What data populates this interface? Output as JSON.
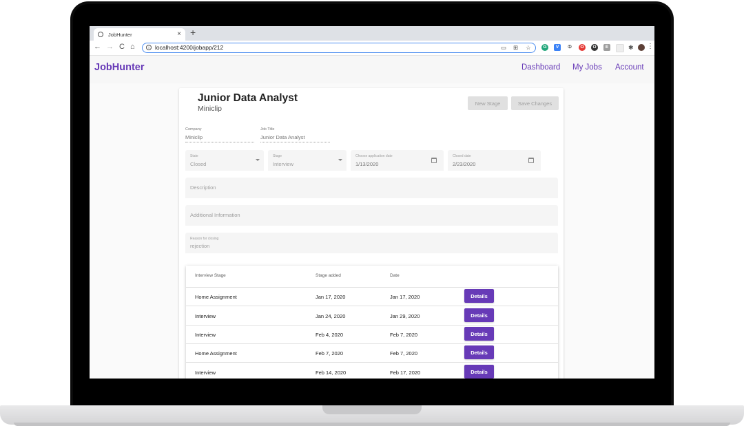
{
  "browser": {
    "tab_title": "JobHunter",
    "tab_close": "×",
    "new_tab": "+",
    "url": "localhost:4200/jobapp/212",
    "nav": {
      "back": "←",
      "forward": "→",
      "reload": "C",
      "home": "⌂"
    },
    "omnibox_icons": [
      "▭",
      "⊞",
      "☆"
    ],
    "extensions": [
      {
        "glyph": "G",
        "color": "#21a67a"
      },
      {
        "glyph": "V",
        "color": "#3b82f6"
      },
      {
        "glyph": "①",
        "color": "#444444"
      },
      {
        "glyph": "O",
        "color": "#e53935"
      },
      {
        "glyph": "O",
        "color": "#333333"
      },
      {
        "glyph": "E",
        "color": "#9e9e9e"
      },
      {
        "glyph": "",
        "color": "#eeeeee"
      }
    ],
    "menu": "⋮"
  },
  "app": {
    "brand": "JobHunter",
    "nav": {
      "dashboard": "Dashboard",
      "my_jobs": "My Jobs",
      "account": "Account"
    }
  },
  "job": {
    "title": "Junior Data Analyst",
    "company_name": "Miniclip",
    "buttons": {
      "new_stage": "New Stage",
      "save_changes": "Save Changes"
    },
    "fields": {
      "company": {
        "label": "Company",
        "value": "Miniclip"
      },
      "job_title": {
        "label": "Job Title",
        "value": "Junior Data Analyst"
      },
      "state": {
        "label": "State",
        "value": "Closed"
      },
      "stage": {
        "label": "Stage",
        "value": "Interview"
      },
      "application_date": {
        "label": "Choose application date",
        "value": "1/13/2020"
      },
      "closed_date": {
        "label": "Closed date",
        "value": "2/23/2020"
      },
      "description": {
        "placeholder": "Description"
      },
      "additional_info": {
        "placeholder": "Additional Information"
      },
      "reason": {
        "label": "Reason for closing",
        "value": "rejection"
      }
    }
  },
  "stages_table": {
    "headers": {
      "stage": "Interview Stage",
      "added": "Stage added",
      "date": "Date"
    },
    "details_label": "Details",
    "rows": [
      {
        "stage": "Home Assignment",
        "added": "Jan 17, 2020",
        "date": "Jan 17, 2020"
      },
      {
        "stage": "Interview",
        "added": "Jan 24, 2020",
        "date": "Jan 29, 2020"
      },
      {
        "stage": "Interview",
        "added": "Feb 4, 2020",
        "date": "Feb 7, 2020"
      },
      {
        "stage": "Home Assignment",
        "added": "Feb 7, 2020",
        "date": "Feb 7, 2020"
      },
      {
        "stage": "Interview",
        "added": "Feb 14, 2020",
        "date": "Feb 17, 2020"
      }
    ]
  }
}
